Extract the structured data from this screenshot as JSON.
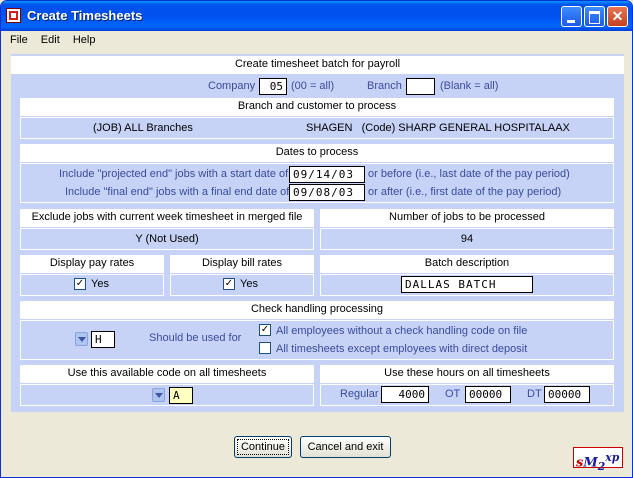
{
  "window": {
    "title": "Create Timesheets"
  },
  "menu": {
    "file": "File",
    "edit": "Edit",
    "help": "Help"
  },
  "payroll": {
    "header": "Create timesheet batch for payroll",
    "company_label": "Company",
    "company_value": "05",
    "company_hint": "(00 = all)",
    "branch_label": "Branch",
    "branch_value": "",
    "branch_hint": "(Blank = all)"
  },
  "branch_customer": {
    "header": "Branch and customer to process",
    "branch_text": "(JOB) ALL Branches",
    "customer_text": "SHAGEN   (Code) SHARP GENERAL HOSPITALAAX"
  },
  "dates": {
    "header": "Dates to process",
    "projected_label": "Include \"projected end\" jobs with a start date of",
    "projected_value": "09/14/03",
    "projected_suffix": "or before  (i.e., last date of the pay period)",
    "final_label": "Include \"final end\" jobs with a final end date of",
    "final_value": "09/08/03",
    "final_suffix": "or after  (i.e., first date of the pay period)"
  },
  "exclude": {
    "header": "Exclude jobs with current week timesheet in merged file",
    "value": "Y (Not Used)"
  },
  "jobs_count": {
    "header": "Number of jobs to be processed",
    "value": "94"
  },
  "pay_rates": {
    "header": "Display pay rates",
    "label": "Yes",
    "checked": true
  },
  "bill_rates": {
    "header": "Display bill rates",
    "label": "Yes",
    "checked": true
  },
  "batch": {
    "header": "Batch description",
    "value": "DALLAS BATCH"
  },
  "check_handling": {
    "header": "Check handling processing",
    "code_value": "H",
    "used_for_label": "Should be used for",
    "opt1_label": "All employees without a check handling code on file",
    "opt1_checked": true,
    "opt2_label": "All timesheets except employees with direct deposit",
    "opt2_checked": false
  },
  "available_code": {
    "header": "Use this available code on all timesheets",
    "value": "A"
  },
  "hours": {
    "header": "Use these hours on all timesheets",
    "regular_label": "Regular",
    "regular_value": "4000",
    "ot_label": "OT",
    "ot_value": "00000",
    "dt_label": "DT",
    "dt_value": "00000"
  },
  "buttons": {
    "continue": "Continue",
    "cancel": "Cancel and exit"
  },
  "logo": {
    "text_s": "s",
    "text_m": "M",
    "text_2": "2",
    "text_xp": "xp"
  }
}
